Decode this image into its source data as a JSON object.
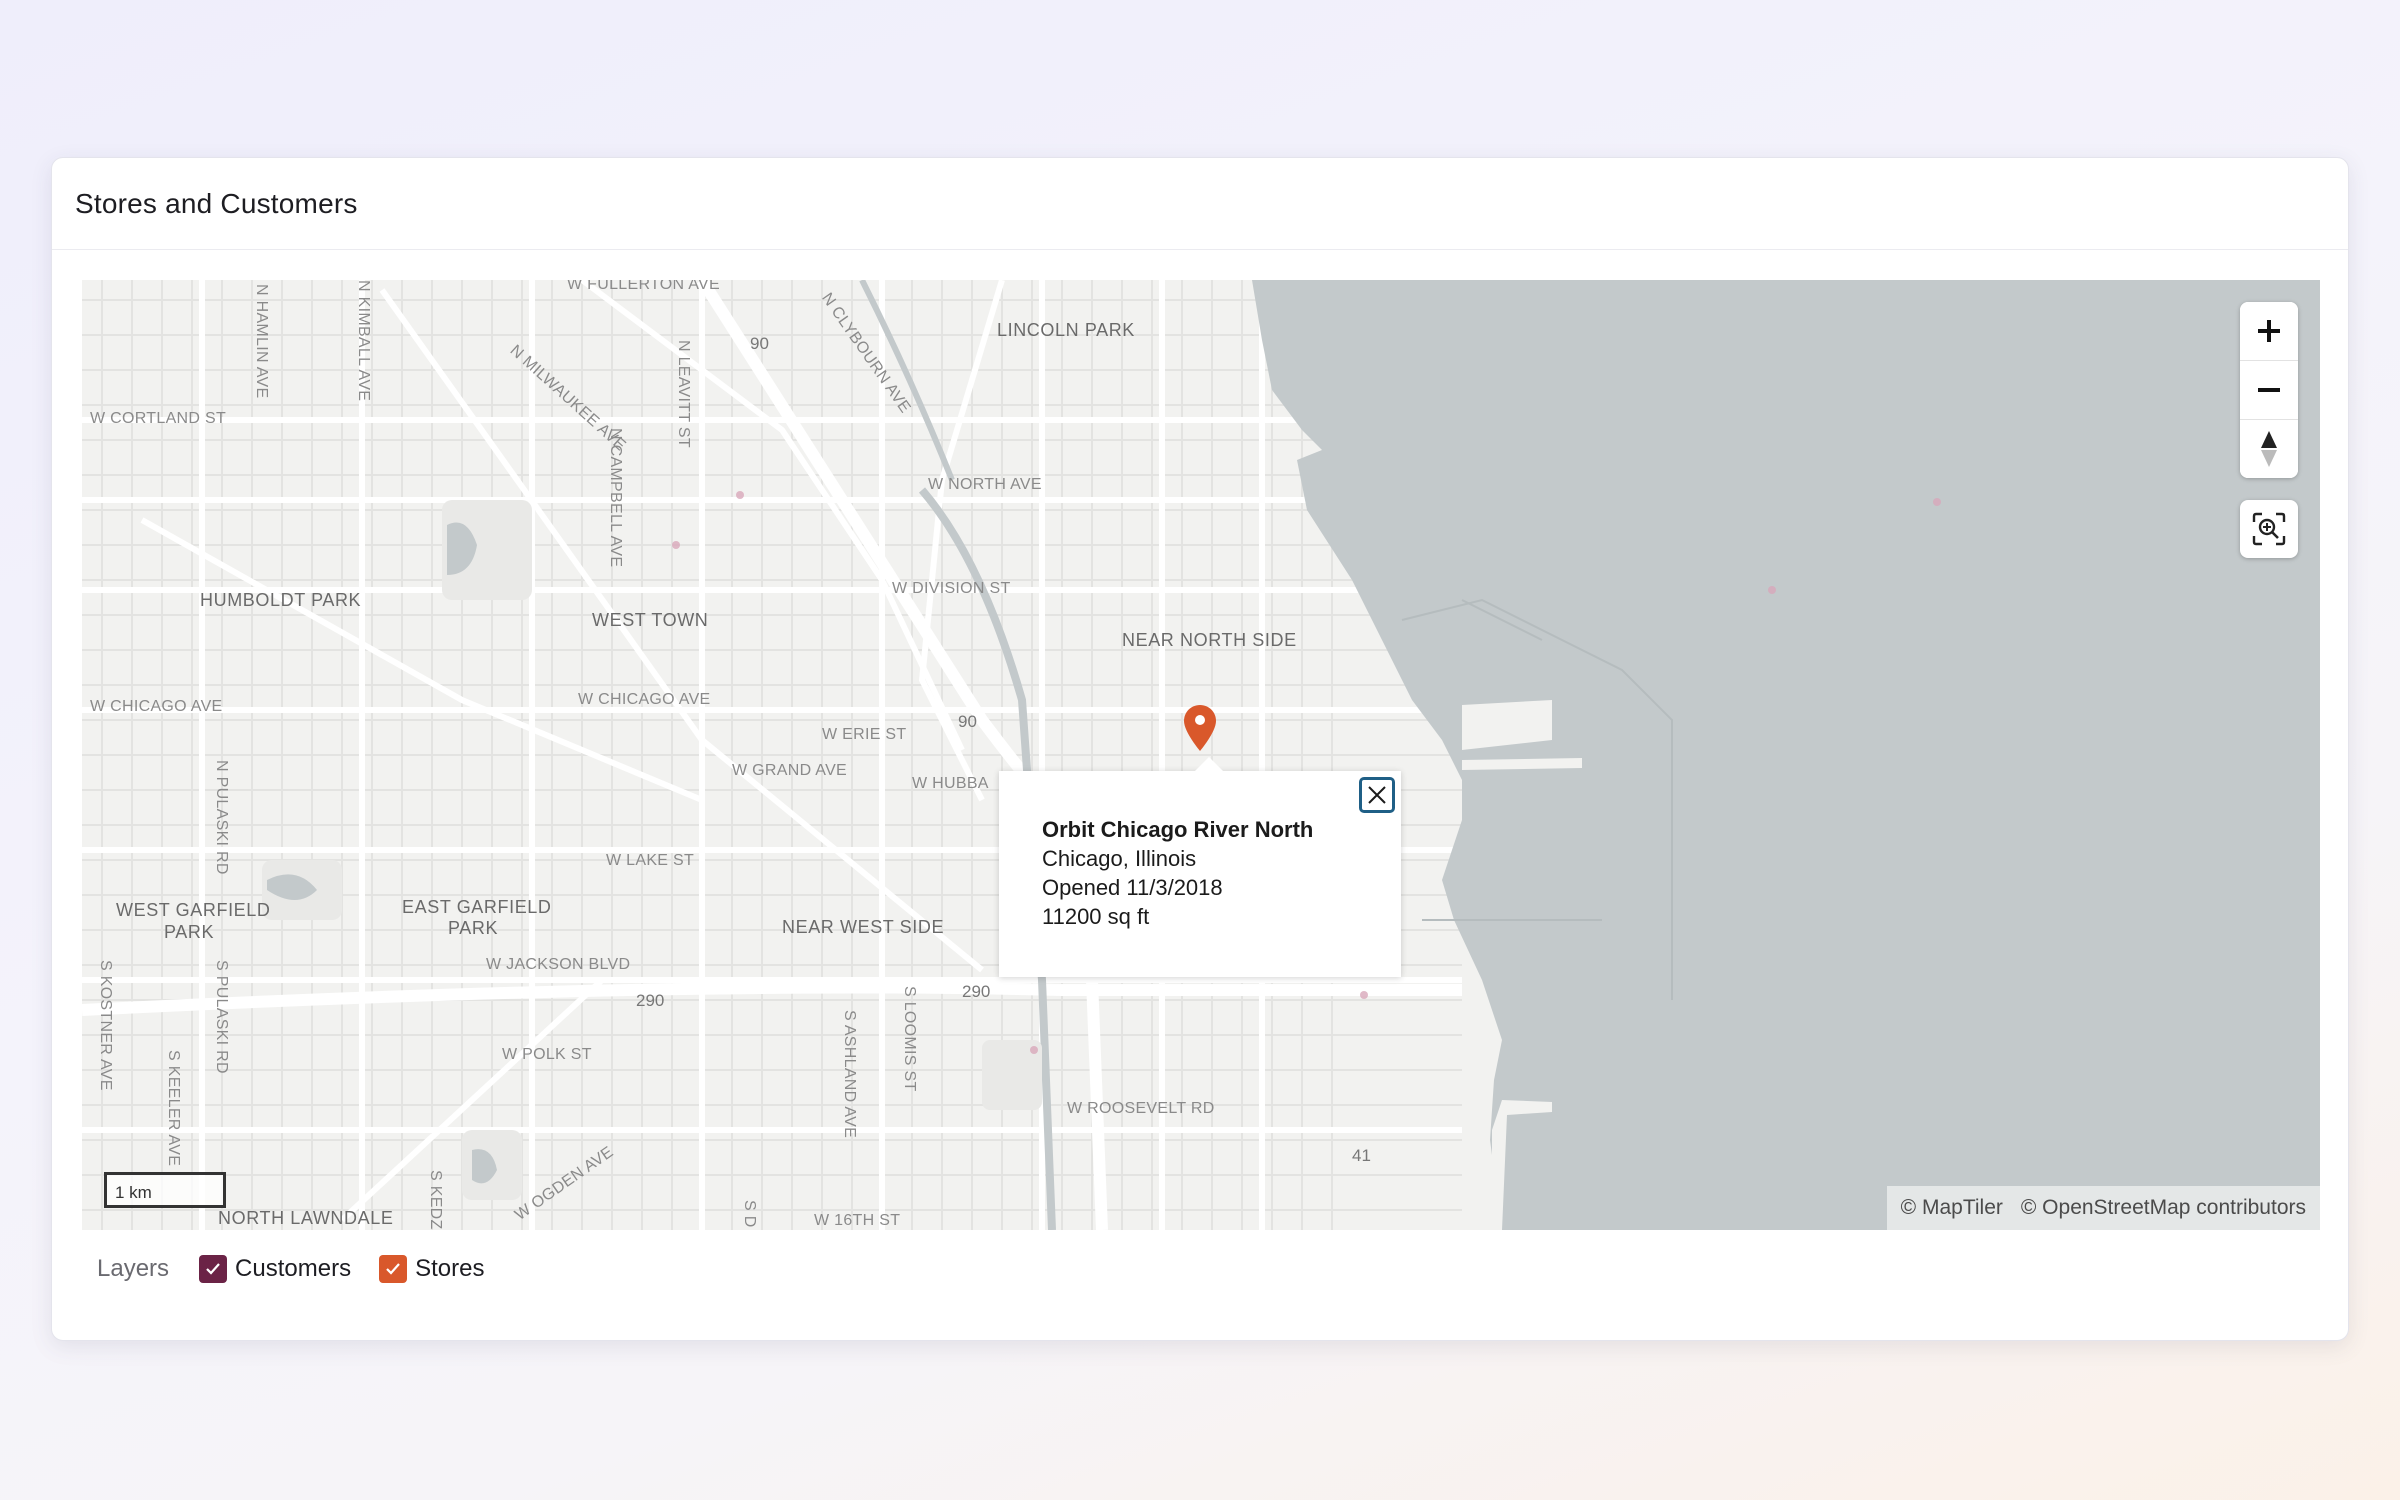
{
  "card": {
    "title": "Stores and Customers"
  },
  "map": {
    "labels": {
      "w_fullerton_ave": "W FULLERTON AVE",
      "lincoln_park": "LINCOLN PARK",
      "w_cortland_st": "W CORTLAND ST",
      "n_milwaukee_ave": "N MILWAUKEE AVE",
      "n_leavitt_st": "N LEAVITT ST",
      "n_clybourn_ave": "N CLYBOURN AVE",
      "n_hamlin_ave": "N HAMLIN AVE",
      "n_kimball_ave": "N KIMBALL AVE",
      "n_campbell_ave": "N CAMPBELL AVE",
      "w_north_ave": "W NORTH AVE",
      "w_division_st": "W DIVISION ST",
      "humboldt_park": "HUMBOLDT PARK",
      "west_town": "WEST TOWN",
      "near_north_side": "NEAR NORTH SIDE",
      "w_chicago_ave_1": "W CHICAGO AVE",
      "w_chicago_ave_2": "W CHICAGO AVE",
      "w_erie_st": "W ERIE ST",
      "w_grand_ave": "W GRAND AVE",
      "w_hubbard": "W HUBBA",
      "n_pulaski_rd": "N PULASKI RD",
      "w_lake_st": "W LAKE ST",
      "west_garfield_park_1": "WEST GARFIELD",
      "west_garfield_park_2": "PARK",
      "east_garfield_park_1": "EAST GARFIELD",
      "east_garfield_park_2": "PARK",
      "near_west_side": "NEAR WEST SIDE",
      "w_jackson_blvd": "W JACKSON BLVD",
      "s_pulaski_rd": "S PULASKI RD",
      "s_kostner_ave": "S KOSTNER AVE",
      "s_keeler_ave": "S KEELER AVE",
      "s_ashland_ave": "S ASHLAND AVE",
      "s_loomis_st": "S LOOMIS ST",
      "w_polk_st": "W POLK ST",
      "w_roosevelt_rd": "W ROOSEVELT RD",
      "w_ogden_ave": "W OGDEN AVE",
      "north_lawndale": "NORTH LAWNDALE",
      "w_16th_st": "W 16TH ST",
      "s_kedz": "S KEDZ",
      "s_d": "S D"
    },
    "road_numbers": {
      "i90_north": "90",
      "i90_center": "90",
      "i290_west": "290",
      "i290_east": "290",
      "r41": "41"
    },
    "scale_label": "1 km",
    "attribution": {
      "maptiler": "© MapTiler",
      "osm": "© OpenStreetMap contributors"
    },
    "controls": {
      "zoom_in": "+",
      "zoom_out": "−"
    }
  },
  "popup": {
    "store_name": "Orbit Chicago River North",
    "location": "Chicago, Illinois",
    "opened": "Opened 11/3/2018",
    "size": "11200 sq ft"
  },
  "layers": {
    "label": "Layers",
    "items": [
      {
        "label": "Customers",
        "color": "#6b2346",
        "checked": true
      },
      {
        "label": "Stores",
        "color": "#d9582b",
        "checked": true
      }
    ]
  },
  "colors": {
    "water": "#c3c9cb",
    "land": "#f2f2f0",
    "store_marker": "#d9582b",
    "customers_layer": "#6b2346",
    "popup_close_border": "#1f5f86"
  }
}
